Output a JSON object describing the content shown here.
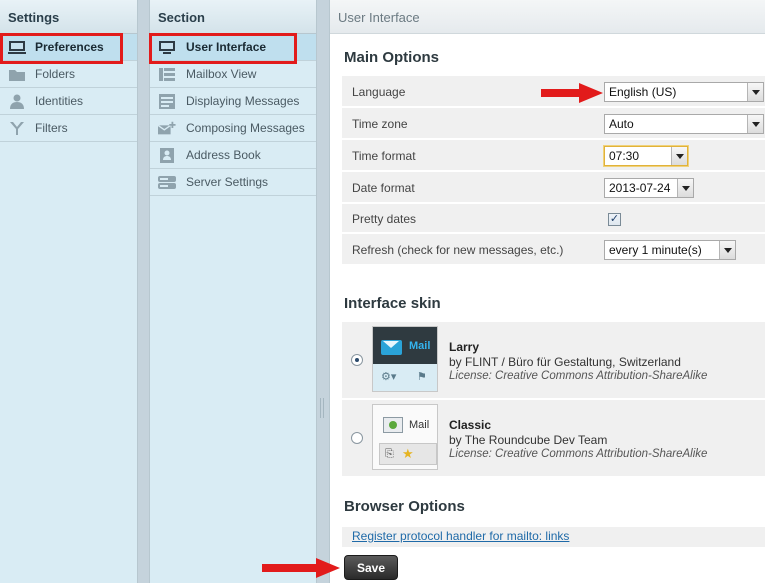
{
  "settings": {
    "header": "Settings",
    "items": [
      {
        "label": "Preferences",
        "icon": "monitor-icon",
        "selected": true
      },
      {
        "label": "Folders",
        "icon": "folder-icon",
        "selected": false
      },
      {
        "label": "Identities",
        "icon": "person-icon",
        "selected": false
      },
      {
        "label": "Filters",
        "icon": "filter-icon",
        "selected": false
      }
    ]
  },
  "section": {
    "header": "Section",
    "items": [
      {
        "label": "User Interface",
        "icon": "monitor-icon",
        "selected": true
      },
      {
        "label": "Mailbox View",
        "icon": "list-view-icon",
        "selected": false
      },
      {
        "label": "Displaying Messages",
        "icon": "document-icon",
        "selected": false
      },
      {
        "label": "Composing Messages",
        "icon": "compose-mail-icon",
        "selected": false
      },
      {
        "label": "Address Book",
        "icon": "contact-card-icon",
        "selected": false
      },
      {
        "label": "Server Settings",
        "icon": "server-icon",
        "selected": false
      }
    ]
  },
  "main": {
    "header": "User Interface",
    "main_options_title": "Main Options",
    "options": [
      {
        "label": "Language",
        "value": "English (US)"
      },
      {
        "label": "Time zone",
        "value": "Auto"
      },
      {
        "label": "Time format",
        "value": "07:30"
      },
      {
        "label": "Date format",
        "value": "2013-07-24"
      },
      {
        "label": "Pretty dates",
        "checked": true
      },
      {
        "label": "Refresh (check for new messages, etc.)",
        "value": "every 1 minute(s)"
      }
    ],
    "skin_title": "Interface skin",
    "skins": [
      {
        "name": "Larry",
        "thumb_label": "Mail",
        "author": "by FLINT / Büro für Gestaltung, Switzerland",
        "license": "License: Creative Commons Attribution-ShareAlike",
        "selected": true
      },
      {
        "name": "Classic",
        "thumb_label": "Mail",
        "author": "by The Roundcube Dev Team",
        "license": "License: Creative Commons Attribution-ShareAlike",
        "selected": false
      }
    ],
    "browser_title": "Browser Options",
    "protocol_link": "Register protocol handler for mailto: links",
    "save_label": "Save"
  },
  "colors": {
    "highlight": "#e21b1b",
    "sidebar_bg": "#d9ecf4",
    "row_bg": "#f0f0f0",
    "link": "#1f6aa8"
  }
}
